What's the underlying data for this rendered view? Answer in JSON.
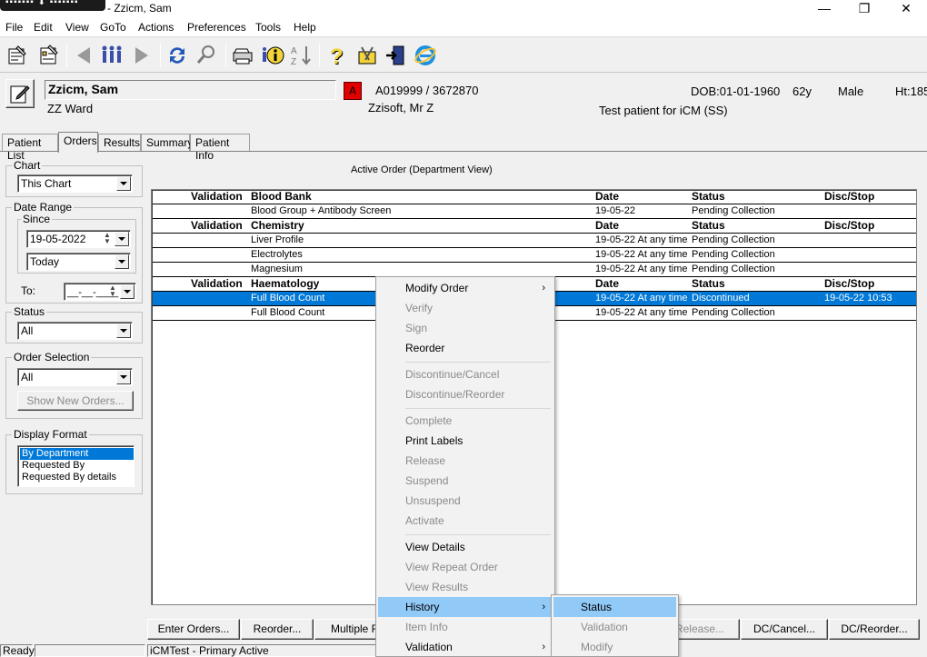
{
  "window": {
    "title": "- Zzicm, Sam",
    "left_badge": "▪▪▪▪▪▪▪ ⬇ ▪▪▪▪▪▪▪",
    "minimize": "—",
    "restore": "❐",
    "close": "✕"
  },
  "menubar": [
    "File",
    "Edit",
    "View",
    "GoTo",
    "Actions",
    "Preferences",
    "Tools",
    "Help"
  ],
  "toolbar": {
    "icons": [
      "patient-list-icon",
      "orders-icon",
      "back-arrow-icon",
      "people-icon",
      "forward-arrow-icon",
      "refresh-icon",
      "search-icon",
      "print-icon",
      "info-icon",
      "sort-icon",
      "help-icon",
      "tools-icon",
      "exit-icon",
      "internet-explorer-icon"
    ]
  },
  "patient": {
    "name": "Zzicm, Sam",
    "ward": "ZZ Ward",
    "alert": "A",
    "ids": "A019999 / 3672870",
    "consultant": "Zzisoft, Mr Z",
    "dob": "DOB:01-01-1960",
    "age": "62y",
    "sex": "Male",
    "height": "Ht:185",
    "note": "Test patient for iCM (SS)"
  },
  "tabs": [
    "Patient List",
    "Orders",
    "Results",
    "Summary",
    "Patient Info"
  ],
  "filters": {
    "chart_label": "Chart",
    "chart_value": "This Chart",
    "date_range_label": "Date Range",
    "since_label": "Since",
    "since_date": "19-05-2022",
    "since_period": "Today",
    "to_label": "To:",
    "to_value": "__-__-____",
    "status_label": "Status",
    "status_value": "All",
    "order_selection_label": "Order Selection",
    "order_selection_value": "All",
    "show_new_orders": "Show New Orders...",
    "display_format_label": "Display Format",
    "display_formats": [
      "By Department",
      "Requested By",
      "Requested By details"
    ]
  },
  "grid": {
    "caption": "Active Order (Department View)",
    "groups": [
      {
        "validation": "Validation",
        "department": "Blood Bank",
        "date": "Date",
        "status": "Status",
        "disc": "Disc/Stop",
        "rows": [
          {
            "order": "Blood Group + Antibody Screen",
            "date": "19-05-22",
            "status": "Pending Collection",
            "disc": ""
          }
        ]
      },
      {
        "validation": "Validation",
        "department": "Chemistry",
        "date": "Date",
        "status": "Status",
        "disc": "Disc/Stop",
        "rows": [
          {
            "order": "Liver Profile",
            "date": "19-05-22 At any time",
            "status": "Pending Collection",
            "disc": ""
          },
          {
            "order": "Electrolytes",
            "date": "19-05-22 At any time",
            "status": "Pending Collection",
            "disc": ""
          },
          {
            "order": "Magnesium",
            "date": "19-05-22 At any time",
            "status": "Pending Collection",
            "disc": ""
          }
        ]
      },
      {
        "validation": "Validation",
        "department": "Haematology",
        "date": "Date",
        "status": "Status",
        "disc": "Disc/Stop",
        "rows": [
          {
            "order": "Full Blood Count",
            "date": "19-05-22 At any time",
            "status": "Discontinued",
            "disc": "19-05-22 10:53"
          },
          {
            "order": "Full Blood Count",
            "date": "19-05-22 At any time",
            "status": "Pending Collection",
            "disc": ""
          }
        ]
      }
    ]
  },
  "context_menu": {
    "items": [
      "Modify Order",
      "Verify",
      "Sign",
      "Reorder",
      "Discontinue/Cancel",
      "Discontinue/Reorder",
      "Complete",
      "Print Labels",
      "Release",
      "Suspend",
      "Unsuspend",
      "Activate",
      "View Details",
      "View Repeat Order",
      "View Results",
      "History",
      "Item Info",
      "Validation"
    ],
    "submenu_arrow": "›"
  },
  "history_submenu": {
    "items": [
      "Status",
      "Validation",
      "Modify"
    ]
  },
  "buttons": {
    "enter_orders": "Enter Orders...",
    "reorder": "Reorder...",
    "multiple": "Multiple R",
    "release": "Release...",
    "dc_cancel": "DC/Cancel...",
    "dc_reorder": "DC/Reorder..."
  },
  "statusbar": {
    "state": "Ready",
    "system": "iCMTest - Primary Active"
  }
}
